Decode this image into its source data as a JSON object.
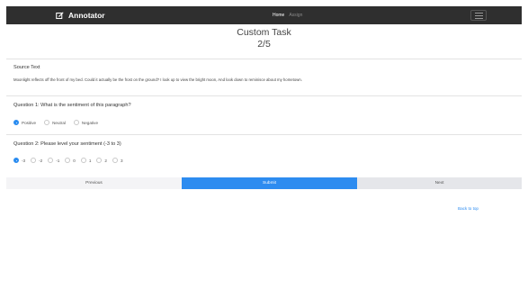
{
  "navbar": {
    "brand": "Annotator",
    "brand_icon": "edit-square-icon",
    "links": {
      "home": "Home",
      "assign": "Assign"
    },
    "menu_icon": "hamburger-icon",
    "colors": {
      "bg": "#2f2f2f",
      "active": "#ffffff",
      "inactive": "#8a8a8a"
    }
  },
  "page": {
    "title": "Custom Task",
    "progress": "2/5"
  },
  "source": {
    "heading": "Source Text",
    "text": "Moonlight reflects off the front of my bed. Could it actually be the frost on the ground? I look up to view the bright moon, And look down to reminisce about my hometown."
  },
  "question1": {
    "label": "Question 1: What is the sentiment of this paragraph?",
    "options": [
      "Positive",
      "Neutral",
      "Negative"
    ],
    "selected": "Positive"
  },
  "question2": {
    "label": "Question 2: Please level your sentiment (-3 to 3)",
    "options": [
      "-3",
      "-2",
      "-1",
      "0",
      "1",
      "2",
      "3"
    ],
    "selected": "-3"
  },
  "buttons": {
    "previous": "Previous",
    "submit": "Submit",
    "next": "Next"
  },
  "footer": {
    "back_to_top": "Back to top"
  },
  "colors": {
    "accent": "#2d8cf0",
    "button_light": "#f4f4f6",
    "button_gray": "#e5e6ea"
  }
}
